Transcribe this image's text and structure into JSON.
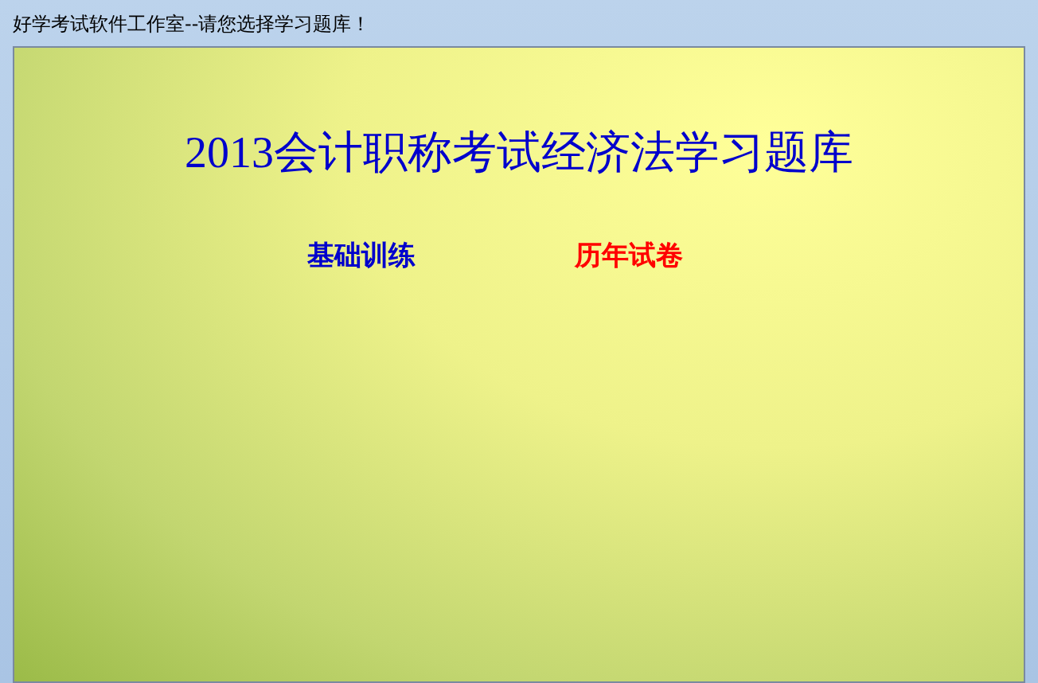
{
  "window": {
    "title": "好学考试软件工作室--请您选择学习题库！"
  },
  "heading": "2013会计职称考试经济法学习题库",
  "links": [
    {
      "label": "基础训练",
      "color": "#0000cc"
    },
    {
      "label": "历年试卷",
      "color": "#ff0000"
    }
  ]
}
